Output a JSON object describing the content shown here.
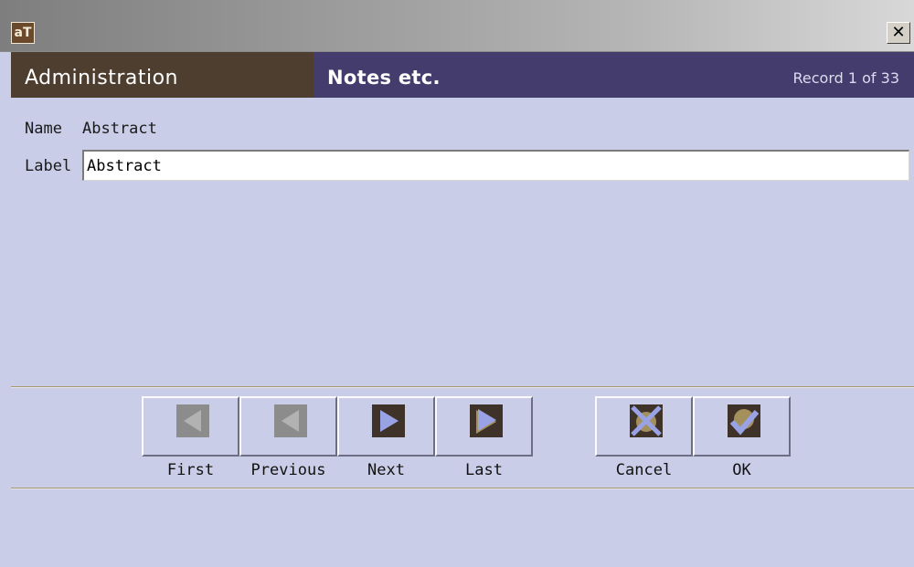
{
  "window": {
    "logo_text": "aT",
    "close_symbol": "✕"
  },
  "header": {
    "admin_label": "Administration",
    "section_title": "Notes etc.",
    "record_status": "Record 1 of 33"
  },
  "form": {
    "name_label": "Name",
    "name_value": "Abstract",
    "label_label": "Label",
    "label_value": "Abstract"
  },
  "navigation": {
    "first": "First",
    "previous": "Previous",
    "next": "Next",
    "last": "Last",
    "cancel": "Cancel",
    "ok": "OK"
  },
  "icons": {
    "first": "first-record-icon",
    "previous": "previous-record-icon",
    "next": "next-record-icon",
    "last": "last-record-icon",
    "cancel": "cancel-x-icon",
    "ok": "ok-check-icon"
  },
  "colors": {
    "background": "#c9cde7",
    "header_purple": "#453c6e",
    "header_brown": "#4e3e30",
    "button_dark": "#3f3329",
    "button_disabled": "#8c8c8c",
    "accent_lavender": "#9aa2e6",
    "accent_tan": "#a3905c"
  }
}
